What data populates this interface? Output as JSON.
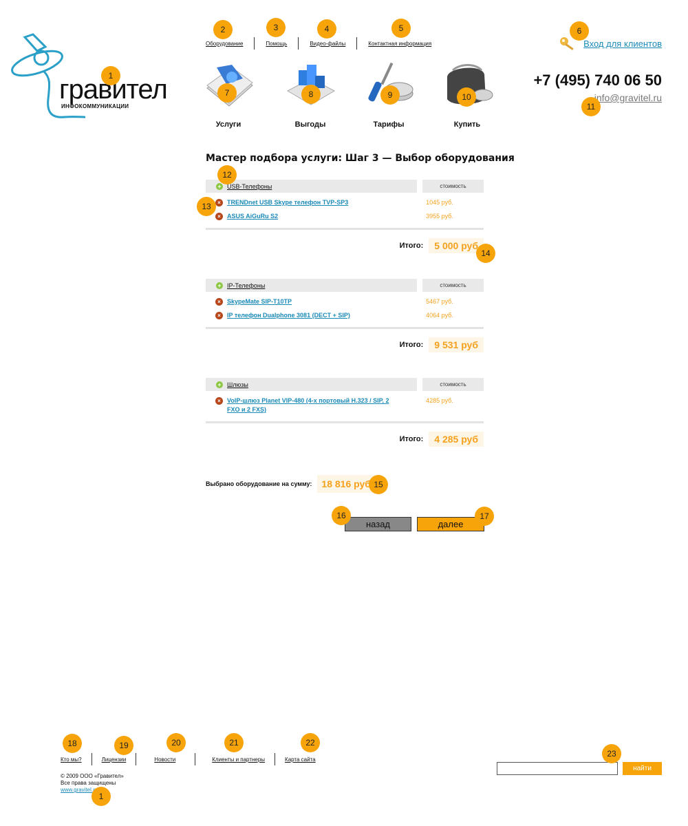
{
  "logo": {
    "name": "гравител",
    "subtitle": "ИНФОКОММУНИКАЦИИ"
  },
  "top_nav": [
    "Оборудование",
    "Помощь",
    "Видео-файлы",
    "Контактная информация"
  ],
  "login": {
    "label": "Вход для клиентов"
  },
  "contact": {
    "phone": "+7 (495) 740 06 50",
    "email": "info@gravitel.ru"
  },
  "tiles": [
    {
      "label": "Услуги",
      "icon": "book-icon"
    },
    {
      "label": "Выгоды",
      "icon": "blocks-icon"
    },
    {
      "label": "Тарифы",
      "icon": "screwdriver-coins-icon"
    },
    {
      "label": "Купить",
      "icon": "wallet-icon"
    }
  ],
  "main": {
    "title": "Мастер подбора услуги: Шаг 3 — Выбор оборудования",
    "cost_header": "стоимость",
    "total_label": "Итого:",
    "sections": [
      {
        "name": "USB-Телефоны",
        "items": [
          {
            "name": "TRENDnet USB Skype телефон TVP-SP3",
            "price": "1045 руб."
          },
          {
            "name": "ASUS AiGuRu S2",
            "price": "3955 руб."
          }
        ],
        "total": "5 000 руб"
      },
      {
        "name": "IP-Телефоны",
        "items": [
          {
            "name": "SkypeMate SIP-T10TP",
            "price": "5467 руб."
          },
          {
            "name": "IP телефон Dualphone 3081 (DECT + SIP)",
            "price": "4064 руб."
          }
        ],
        "total": "9 531 руб"
      },
      {
        "name": "Шлюзы",
        "items": [
          {
            "name": "VoIP-шлюз Planet VIP-480 (4-х портовый H.323 / SIP, 2 FXO и 2 FXS)",
            "price": "4285 руб."
          }
        ],
        "total": "4 285 руб"
      }
    ],
    "grand_label": "Выбрано оборудование на сумму:",
    "grand_total": "18 816 руб",
    "back_label": "назад",
    "next_label": "далее"
  },
  "footer": {
    "nav": [
      "Кто мы?",
      "Лицензии",
      "Новости",
      "Клиенты и партнеры",
      "Карта сайта"
    ],
    "copyright": "© 2009 ООО «Гравител»",
    "rights": "Все права защищены",
    "url": "www.gravitel.ru",
    "search_button": "найти",
    "search_value": ""
  },
  "markers": [
    "1",
    "2",
    "3",
    "4",
    "5",
    "6",
    "7",
    "8",
    "9",
    "10",
    "11",
    "12",
    "13",
    "14",
    "15",
    "16",
    "17",
    "18",
    "19",
    "20",
    "21",
    "22",
    "23",
    "1"
  ],
  "colors": {
    "accent": "#f7a30a",
    "link": "#1a8ab8",
    "price": "#f5a11c"
  }
}
